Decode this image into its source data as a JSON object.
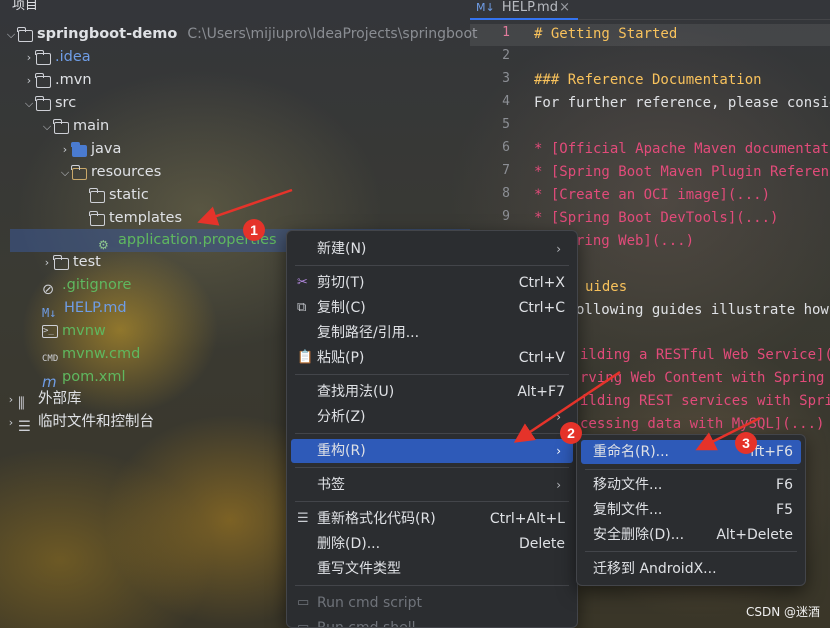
{
  "project_panel": {
    "header": "项目",
    "root_name": "springboot-demo",
    "root_path": "C:\\Users\\mijiupro\\IdeaProjects\\springboot",
    "items": {
      "idea": ".idea",
      "mvn": ".mvn",
      "src": "src",
      "main": "main",
      "java": "java",
      "resources": "resources",
      "static": "static",
      "templates": "templates",
      "application_properties": "application.properties",
      "test": "test",
      "gitignore": ".gitignore",
      "help_md": "HELP.md",
      "mvnw": "mvnw",
      "mvnw_cmd": "mvnw.cmd",
      "pom_xml": "pom.xml",
      "external_libraries": "外部库",
      "scratches": "临时文件和控制台"
    }
  },
  "editor": {
    "tab_label": "HELP.md",
    "tab_icon": "M↓",
    "line_numbers": [
      "1",
      "2",
      "3",
      "4",
      "5",
      "6",
      "7",
      "8",
      "9"
    ],
    "lines": [
      "# Getting Started",
      "",
      "### Reference Documentation",
      "For further reference, please consid",
      "",
      "* [Official Apache Maven documentati",
      "* [Spring Boot Maven Plugin Referenc",
      "* [Create an OCI image](...)",
      "* [Spring Boot DevTools](...)",
      "ring Web](...)",
      "uides",
      "ollowing guides illustrate how",
      "ilding a RESTful Web Service](..",
      "rving Web Content with Spring M",
      "ilding REST services with Sprin",
      "cessing data with MySQL](...)"
    ]
  },
  "context_menu": {
    "new": "新建(N)",
    "cut": "剪切(T)",
    "cut_shortcut": "Ctrl+X",
    "copy": "复制(C)",
    "copy_shortcut": "Ctrl+C",
    "copy_path": "复制路径/引用...",
    "paste": "粘贴(P)",
    "paste_shortcut": "Ctrl+V",
    "find_usages": "查找用法(U)",
    "find_usages_shortcut": "Alt+F7",
    "analyze": "分析(Z)",
    "refactor": "重构(R)",
    "bookmarks": "书签",
    "reformat": "重新格式化代码(R)",
    "reformat_shortcut": "Ctrl+Alt+L",
    "delete": "删除(D)...",
    "delete_shortcut": "Delete",
    "override_type": "重写文件类型",
    "run_cmd": "Run cmd script",
    "run_cmd_shell": "Run cmd shell"
  },
  "refactor_submenu": {
    "rename": "重命名(R)...",
    "rename_shortcut": "ift+F6",
    "move": "移动文件...",
    "move_shortcut": "F6",
    "copy_file": "复制文件...",
    "copy_file_shortcut": "F5",
    "safe_delete": "安全删除(D)...",
    "safe_delete_shortcut": "Alt+Delete",
    "migrate": "迁移到 AndroidX..."
  },
  "annotations": {
    "step1": "1",
    "step2": "2",
    "step3": "3",
    "color": "#e5332a"
  },
  "watermark": "CSDN @迷酒"
}
